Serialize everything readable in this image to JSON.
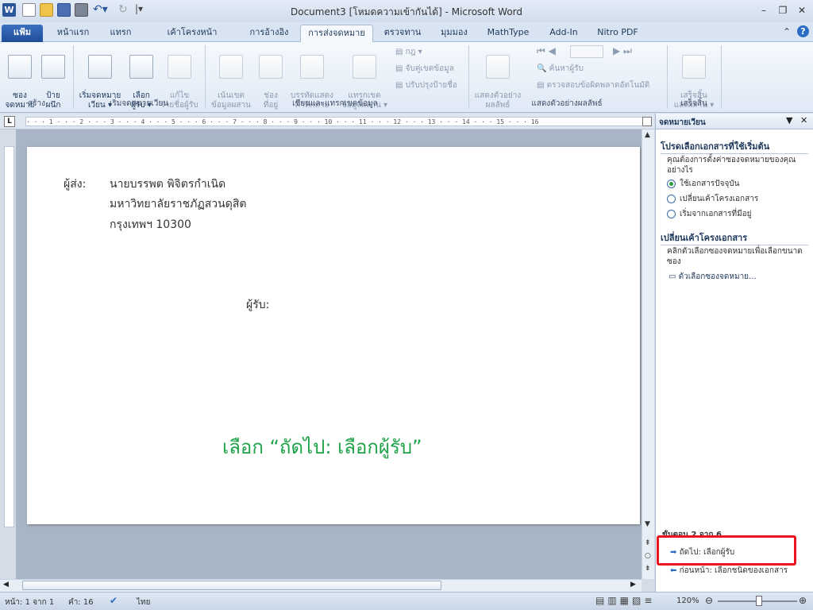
{
  "window": {
    "title": "Document3 [โหมดความเข้ากันได้] - Microsoft Word"
  },
  "tabs": [
    "แฟ้ม",
    "หน้าแรก",
    "แทรก",
    "เค้าโครงหน้ากระดาษ",
    "การอ้างอิง",
    "การส่งจดหมาย",
    "ตรวจทาน",
    "มุมมอง",
    "MathType",
    "Add-In",
    "Nitro PDF"
  ],
  "ribbon": {
    "create": {
      "envelopes": "ซอง\nจดหมาย",
      "labels": "ป้าย\nผนึก",
      "group": "สร้าง"
    },
    "start": {
      "start_merge": "เริ่มจดหมาย\nเวียน ▾",
      "select_recipients": "เลือก\nผู้รับ ▾",
      "edit_list": "แก้ไข\nรายชื่อผู้รับ",
      "group": "เริ่มจดหมายเวียน"
    },
    "write": {
      "highlight": "เน้นเขต\nข้อมูลผสาน",
      "address_block": "ช่อง\nที่อยู่",
      "greeting": "บรรทัดแสดง\nคำทักทาย",
      "insert_field": "แทรกเขต\nข้อมูลผสาน ▾",
      "rules": "กฎ ▾",
      "match_fields": "จับคู่เขตข้อมูล",
      "update_labels": "ปรับปรุงป้ายชื่อ",
      "group": "เขียนและแทรกเขตข้อมูล"
    },
    "preview": {
      "preview_results": "แสดงตัวอย่าง\nผลลัพธ์",
      "find_recipient": "ค้นหาผู้รับ",
      "check_errors": "ตรวจสอบข้อผิดพลาดอัตโนมัติ",
      "group": "แสดงตัวอย่างผลลัพธ์"
    },
    "finish": {
      "finish_merge": "เสร็จสิ้น\nและผสาน ▾",
      "group": "เสร็จสิ้น"
    }
  },
  "ruler": "· · · 1 · · · 2 · · · 3 · · · 4 · · · 5 · · · 6 · · · 7 · · · 8 · · · 9 · · · 10 · · · 11 · · · 12 · · · 13 · · · 14 · · · 15 · · · 16",
  "document": {
    "sender_label": "ผู้ส่ง:",
    "sender_lines": [
      "นายบรรพต พิจิตรกำเนิด",
      "มหาวิทยาลัยราชภัฏสวนดุสิต",
      "กรุงเทพฯ 10300"
    ],
    "recipient_label": "ผู้รับ:",
    "instruction": "เลือก “ถัดไป: เลือกผู้รับ”",
    "instruction_color": "#1fa34a"
  },
  "pane": {
    "title": "จดหมายเวียน",
    "section1": "โปรดเลือกเอกสารที่ใช้เริ่มต้น",
    "question": "คุณต้องการตั้งค่าซองจดหมายของคุณอย่างไร",
    "options": [
      "ใช้เอกสารปัจจุบัน",
      "เปลี่ยนเค้าโครงเอกสาร",
      "เริ่มจากเอกสารที่มีอยู่"
    ],
    "section2": "เปลี่ยนเค้าโครงเอกสาร",
    "section2_text": "คลิกตัวเลือกซองจดหมายเพื่อเลือกขนาดซอง",
    "envelope_options_link": "ตัวเลือกซองจดหมาย...",
    "step": "ขั้นตอน 2 จาก 6",
    "next": "ถัดไป: เลือกผู้รับ",
    "prev": "ก่อนหน้า: เลือกชนิดของเอกสาร",
    "highlight_color": "#e8141e"
  },
  "status": {
    "page": "หน้า: 1 จาก 1",
    "words": "คำ: 16",
    "language": "ไทย",
    "zoom": "120%"
  }
}
